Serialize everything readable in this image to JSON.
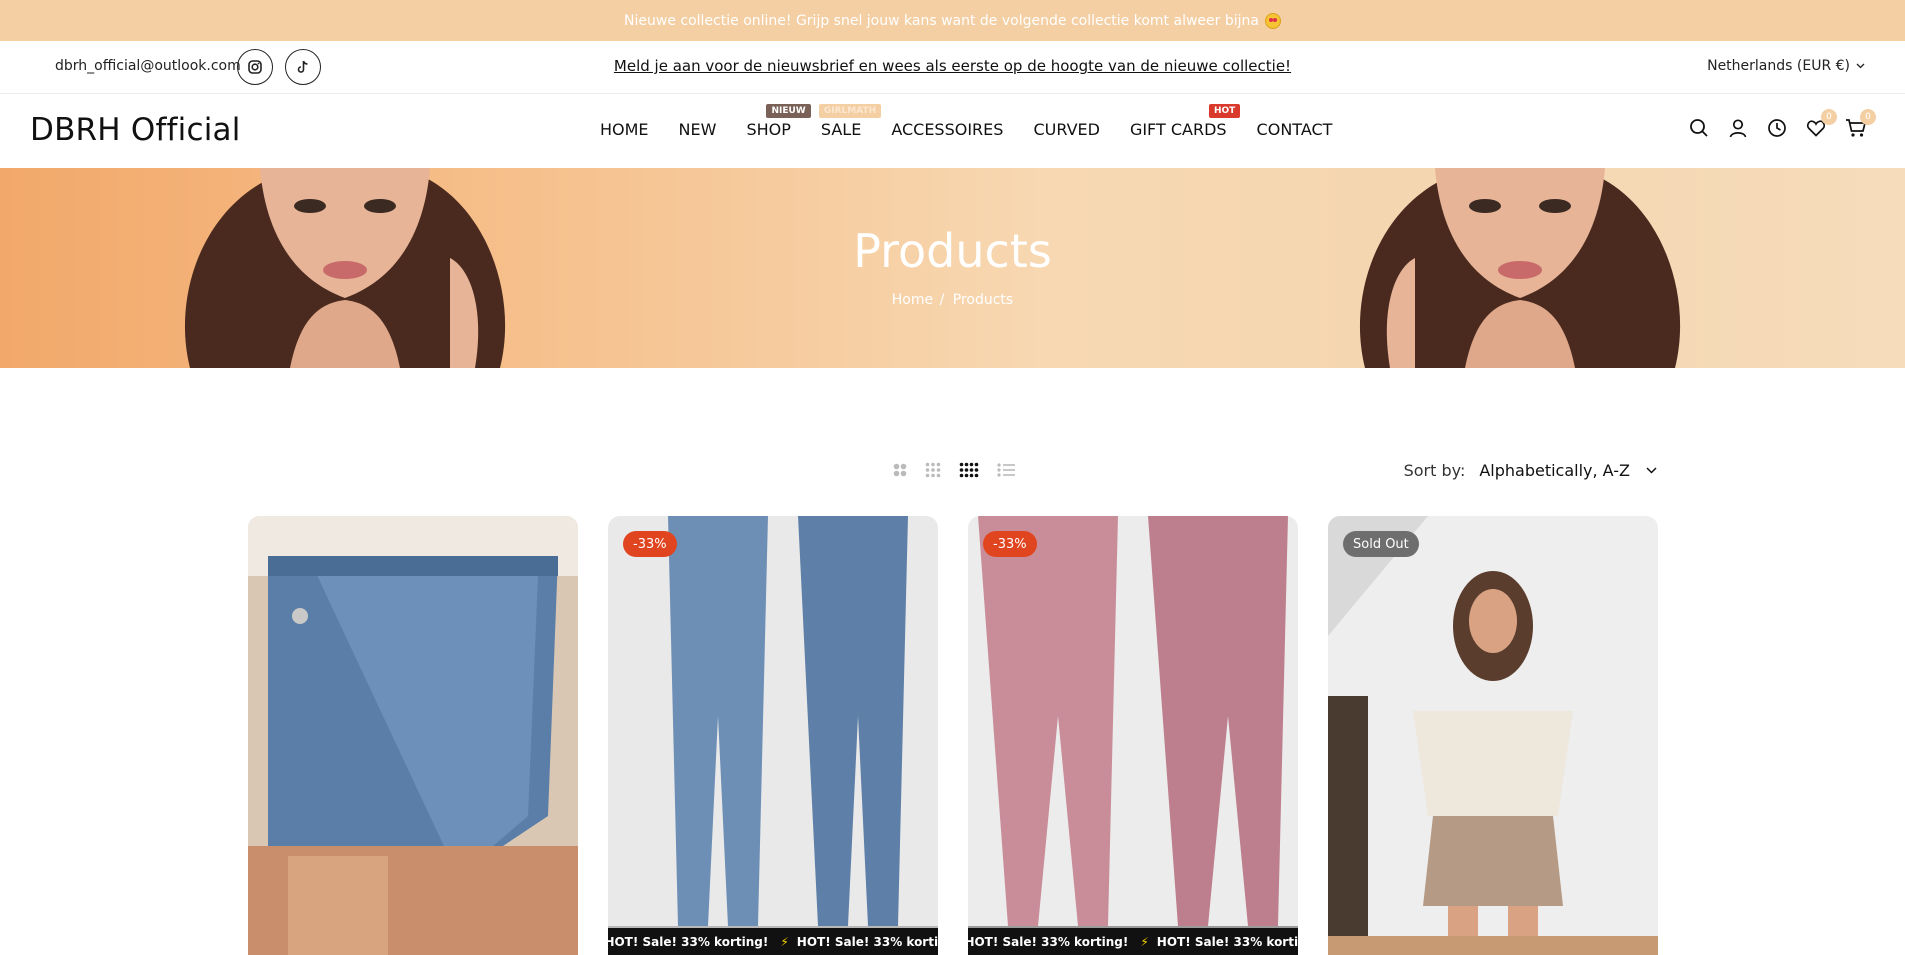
{
  "announcement": {
    "text": "Nieuwe collectie online! Grijp snel jouw kans want de volgende collectie komt alweer bijna"
  },
  "topbar": {
    "email": "dbrh_official@outlook.com",
    "newsletter": "Meld je aan voor de nieuwsbrief en wees als eerste op de hoogte van de nieuwe collectie!",
    "country": "Netherlands (EUR €)"
  },
  "header": {
    "logo": "DBRH Official",
    "nav": [
      {
        "label": "HOME"
      },
      {
        "label": "NEW"
      },
      {
        "label": "SHOP",
        "badge": "NIEUW",
        "badge_color": "#7a6157"
      },
      {
        "label": "SALE",
        "badge": "GIRLMATH",
        "badge_color": "#f4cfa4"
      },
      {
        "label": "ACCESSOIRES"
      },
      {
        "label": "CURVED"
      },
      {
        "label": "GIFT CARDS",
        "badge": "HOT",
        "badge_color": "#d93a2b"
      },
      {
        "label": "CONTACT"
      }
    ],
    "wishlist_count": "0",
    "cart_count": "0"
  },
  "hero": {
    "title": "Products",
    "breadcrumb": [
      "Home",
      "Products"
    ],
    "breadcrumb_sep": "/"
  },
  "toolbar": {
    "sort_label": "Sort by:",
    "sort_value": "Alphabetically, A-Z",
    "active_view": "grid-4"
  },
  "products": [
    {
      "label": "",
      "ticker": ""
    },
    {
      "label": "-33%",
      "label_color": "#e0451f",
      "ticker": "HOT! Sale! 33% korting!"
    },
    {
      "label": "-33%",
      "label_color": "#e0451f",
      "ticker": "HOT! Sale! 33% korting!"
    },
    {
      "label": "Sold Out",
      "label_color": "#6e6e6e",
      "ticker": ""
    }
  ],
  "colors": {
    "announcement_bg": "#f4cfa4",
    "accent_sale": "#e0451f",
    "badge_hot": "#d93a2b"
  }
}
